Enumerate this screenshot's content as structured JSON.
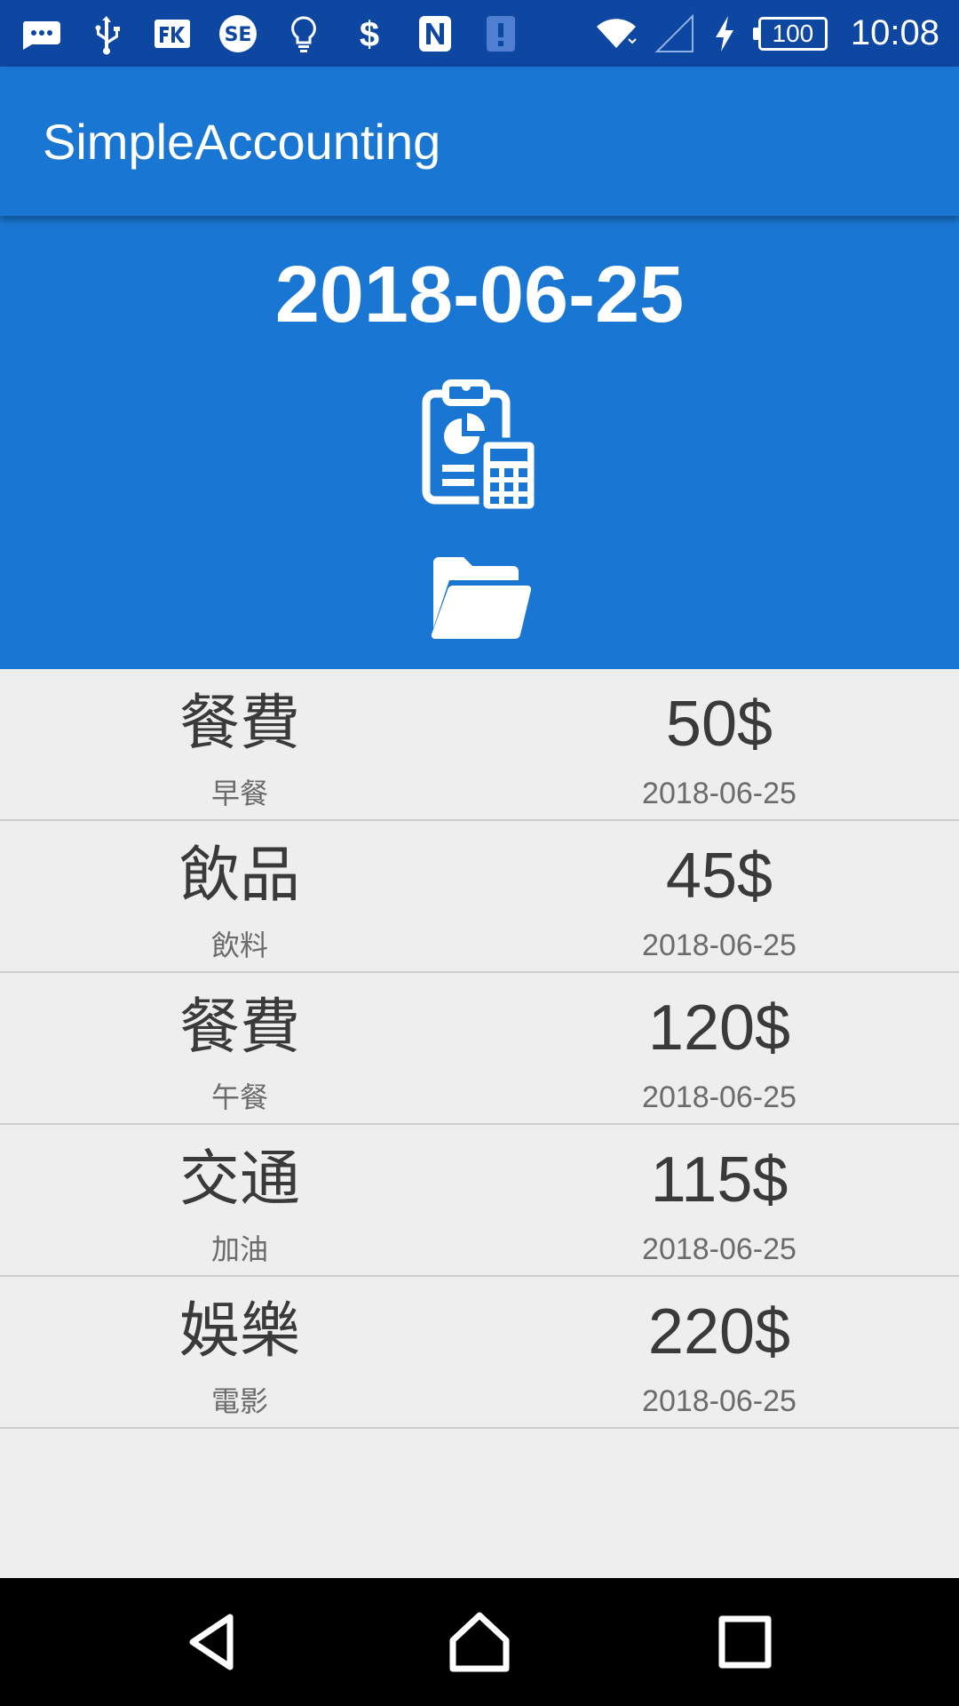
{
  "status_bar": {
    "icons": [
      "message-icon",
      "usb-icon",
      "fk-app-icon",
      "sf-app-icon",
      "lightbulb-icon",
      "dollar-icon",
      "nfc-icon",
      "alert-icon",
      "wifi-icon",
      "signal-icon",
      "charging-icon"
    ],
    "battery_level": "100",
    "time": "10:08"
  },
  "app_bar": {
    "title": "SimpleAccounting"
  },
  "header": {
    "date": "2018-06-25",
    "report_icon": "clipboard-calculator-icon",
    "folder_icon": "folder-open-icon"
  },
  "records": [
    {
      "category": "餐費",
      "note": "早餐",
      "amount": "50$",
      "date": "2018-06-25"
    },
    {
      "category": "飲品",
      "note": "飲料",
      "amount": "45$",
      "date": "2018-06-25"
    },
    {
      "category": "餐費",
      "note": "午餐",
      "amount": "120$",
      "date": "2018-06-25"
    },
    {
      "category": "交通",
      "note": "加油",
      "amount": "115$",
      "date": "2018-06-25"
    },
    {
      "category": "娛樂",
      "note": "電影",
      "amount": "220$",
      "date": "2018-06-25"
    }
  ],
  "nav_bar": {
    "buttons": [
      "back-icon",
      "home-icon",
      "recents-icon"
    ]
  },
  "colors": {
    "status_bar": "#0d47a1",
    "primary": "#1976d2",
    "background": "#eeeeee",
    "text_primary": "#3a3a3a",
    "text_secondary": "#6b6b6b"
  }
}
